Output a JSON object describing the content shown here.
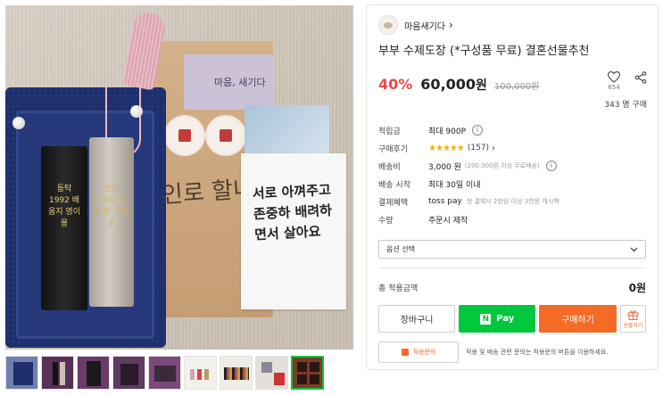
{
  "seller": {
    "name": "마음새기다"
  },
  "product": {
    "title": "부부 수제도장 (*구성품 무료) 결혼선물추천",
    "discount": "40%",
    "price": "60,000",
    "price_unit": "원",
    "original_price": "100,000원",
    "wishlist_count": "654",
    "purchase_count": "343 명 구매"
  },
  "info": {
    "points_label": "적립금",
    "points_value": "최대 900P",
    "review_label": "구매후기",
    "review_stars": "★★★★★",
    "review_count": "(157)",
    "shipping_label": "배송비",
    "shipping_value": "3,000 원",
    "shipping_note": "(200,000원 이상 무료배송)",
    "ship_start_label": "배송 시작",
    "ship_start_value": "최대 30일 이내",
    "payment_label": "결제혜택",
    "payment_value": "toss pay",
    "payment_note": "첫 결제시 2만원 이상 3천원 캐시백",
    "quantity_label": "수량",
    "quantity_value": "주문시 제작"
  },
  "option": {
    "placeholder": "옵션 선택"
  },
  "total": {
    "label": "총 적용금액",
    "value": "0원"
  },
  "buttons": {
    "cart": "장바구니",
    "npay": "Pay",
    "buy": "구매하기",
    "gift": "선물하기",
    "qa": "적용문의",
    "qa_note": "적용 및 배송 관련 문의는 적용문의 버튼을 이용하세요."
  },
  "photo": {
    "card_text": "마음, 새기다",
    "kraft_text": "인로 할니다",
    "white_card_text": "서로 아껴주고 존중하 배려하면서 살아요",
    "engrave_a": "동탁 1992 배움지 영이용",
    "engrave_b": "선희 1992 누러진 스러운"
  },
  "colors": {
    "discount_red": "#f04646",
    "npay_green": "#00c73c",
    "buy_orange": "#f46b28",
    "star_yellow": "#f5b400",
    "box_blue": "#1e2f6e"
  },
  "icons": {
    "wishlist": "heart-icon",
    "share": "share-icon",
    "help": "info-circle-icon",
    "gift": "gift-icon",
    "dropdown": "chevron-down-icon"
  }
}
